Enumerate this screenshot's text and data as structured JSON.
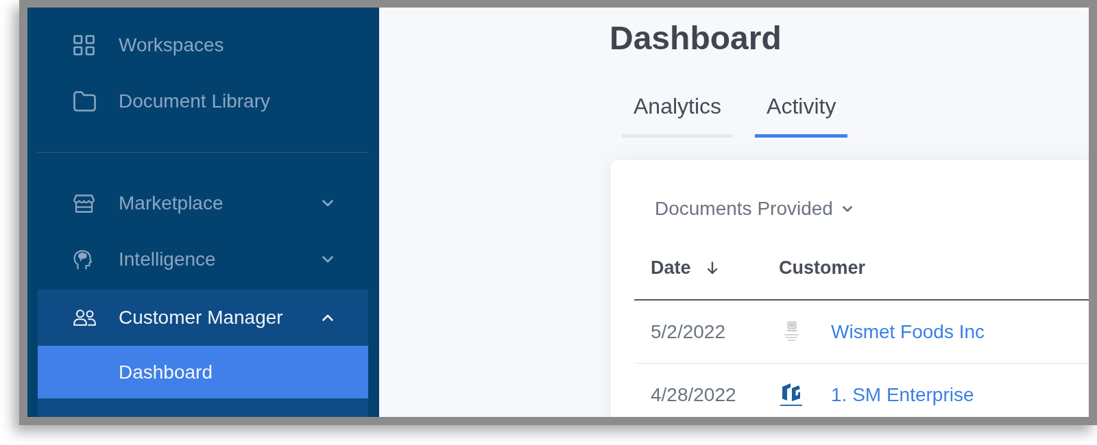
{
  "sidebar": {
    "top_items": [
      {
        "label": "Workspaces"
      },
      {
        "label": "Document Library"
      }
    ],
    "menu_groups": [
      {
        "label": "Marketplace",
        "expanded": false
      },
      {
        "label": "Intelligence",
        "expanded": false
      },
      {
        "label": "Customer Manager",
        "expanded": true,
        "children": [
          {
            "label": "Dashboard",
            "selected": true
          }
        ]
      }
    ]
  },
  "main": {
    "title": "Dashboard",
    "tabs": [
      {
        "label": "Analytics",
        "selected": false
      },
      {
        "label": "Activity",
        "selected": true
      }
    ],
    "card": {
      "filter": {
        "label": "Documents Provided"
      },
      "table": {
        "columns": [
          {
            "label": "Date",
            "sorted": true
          },
          {
            "label": "Customer",
            "sorted": false
          }
        ],
        "rows": [
          {
            "date": "5/2/2022",
            "customer": "Wismet Foods Inc"
          },
          {
            "date": "4/28/2022",
            "customer": "1. SM Enterprise"
          }
        ]
      }
    }
  }
}
